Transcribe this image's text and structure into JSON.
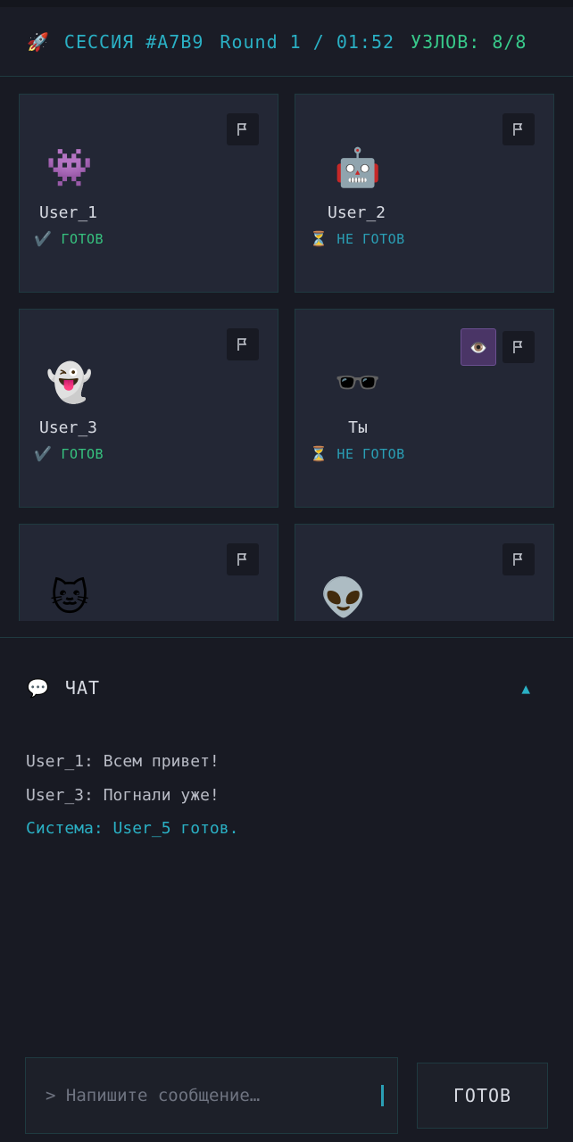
{
  "header": {
    "rocket_icon": "🚀",
    "session": "СЕССИЯ #A7B9",
    "round": "Round 1 / 01:52",
    "nodes": "УЗЛОВ: 8/8"
  },
  "players": [
    {
      "avatar": "👾",
      "name": "User_1",
      "status_icon": "✔️",
      "status": "ГОТОВ",
      "ready": true
    },
    {
      "avatar": "🤖",
      "name": "User_2",
      "status_icon": "⏳",
      "status": "НЕ ГОТОВ",
      "ready": false
    },
    {
      "avatar": "👻",
      "name": "User_3",
      "status_icon": "✔️",
      "status": "ГОТОВ",
      "ready": true
    },
    {
      "avatar": "🕶️",
      "name": "Ты",
      "status_icon": "⏳",
      "status": "НЕ ГОТОВ",
      "ready": false,
      "eye_icon": "👁️"
    },
    {
      "avatar": "🐱"
    },
    {
      "avatar": "👽"
    }
  ],
  "chat": {
    "icon": "💬",
    "title": "ЧАТ",
    "toggle": "▲",
    "messages": [
      {
        "text": "User_1: Всем привет!",
        "system": false
      },
      {
        "text": "User_3: Погнали уже!",
        "system": false
      },
      {
        "text": "Система: User_5 готов.",
        "system": true
      }
    ],
    "input_placeholder": "> Напишите сообщение…",
    "ready_button": "ГОТОВ"
  },
  "colors": {
    "accent": "#2ab0c4",
    "ready": "#36c27f",
    "background": "#181a23",
    "card": "#232735"
  }
}
